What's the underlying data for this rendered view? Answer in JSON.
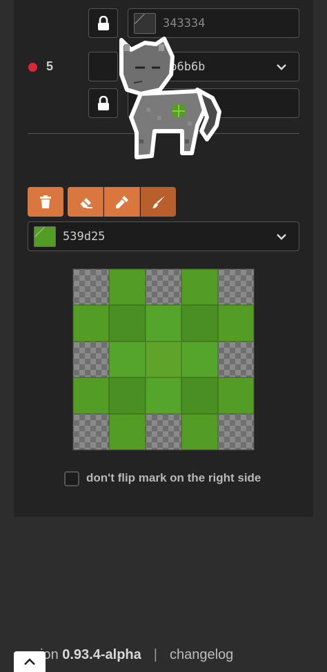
{
  "layers": [
    {
      "lock_color": {
        "value": "343334",
        "locked": true
      }
    },
    {
      "number": "5",
      "dot_color": "#e0243a",
      "main_color": {
        "value": "6b6b6b",
        "has_dropdown": true
      },
      "lock_color": {
        "value": "",
        "locked": true
      }
    }
  ],
  "tools": {
    "delete_icon": "trash-icon",
    "eraser_icon": "eraser-icon",
    "eyedropper_icon": "eyedropper-icon",
    "brush_icon": "brush-icon",
    "active_tool": "brush"
  },
  "color_select": {
    "value": "539d25",
    "swatch": "#539d25"
  },
  "mark_grid": {
    "rows": 5,
    "cols": 5,
    "cells": [
      [
        null,
        "#539d25",
        null,
        "#539d25",
        null
      ],
      [
        "#539d25",
        "#4a8f22",
        "#55a52b",
        "#4a8f22",
        "#539d25"
      ],
      [
        null,
        "#55a52b",
        "#5fa32a",
        "#55a52b",
        null
      ],
      [
        "#539d25",
        "#4a8f22",
        "#55a52b",
        "#4a8f22",
        "#539d25"
      ],
      [
        null,
        "#539d25",
        null,
        "#539d25",
        null
      ]
    ]
  },
  "flip_checkbox": {
    "checked": false,
    "label": "don't flip mark on the right side"
  },
  "footer": {
    "version_prefix": "ion ",
    "version": "0.93.4-alpha",
    "separator": "|",
    "changelog": "changelog"
  },
  "colors": {
    "accent": "#d9773f",
    "accent_active": "#b85f2c",
    "panel": "#232323",
    "background": "#2d2d2d"
  }
}
